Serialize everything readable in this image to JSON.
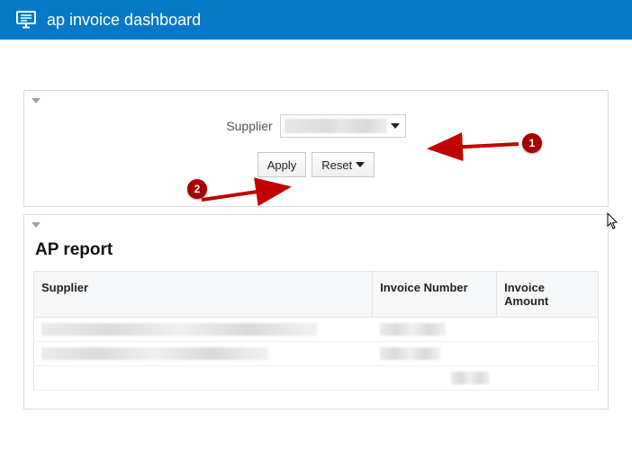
{
  "header": {
    "title": "ap invoice dashboard"
  },
  "filter": {
    "supplier_label": "Supplier",
    "apply_label": "Apply",
    "reset_label": "Reset"
  },
  "report": {
    "title": "AP report",
    "columns": {
      "supplier": "Supplier",
      "invoice_number": "Invoice Number",
      "invoice_amount": "Invoice Amount"
    }
  },
  "annotations": {
    "one": "1",
    "two": "2"
  }
}
